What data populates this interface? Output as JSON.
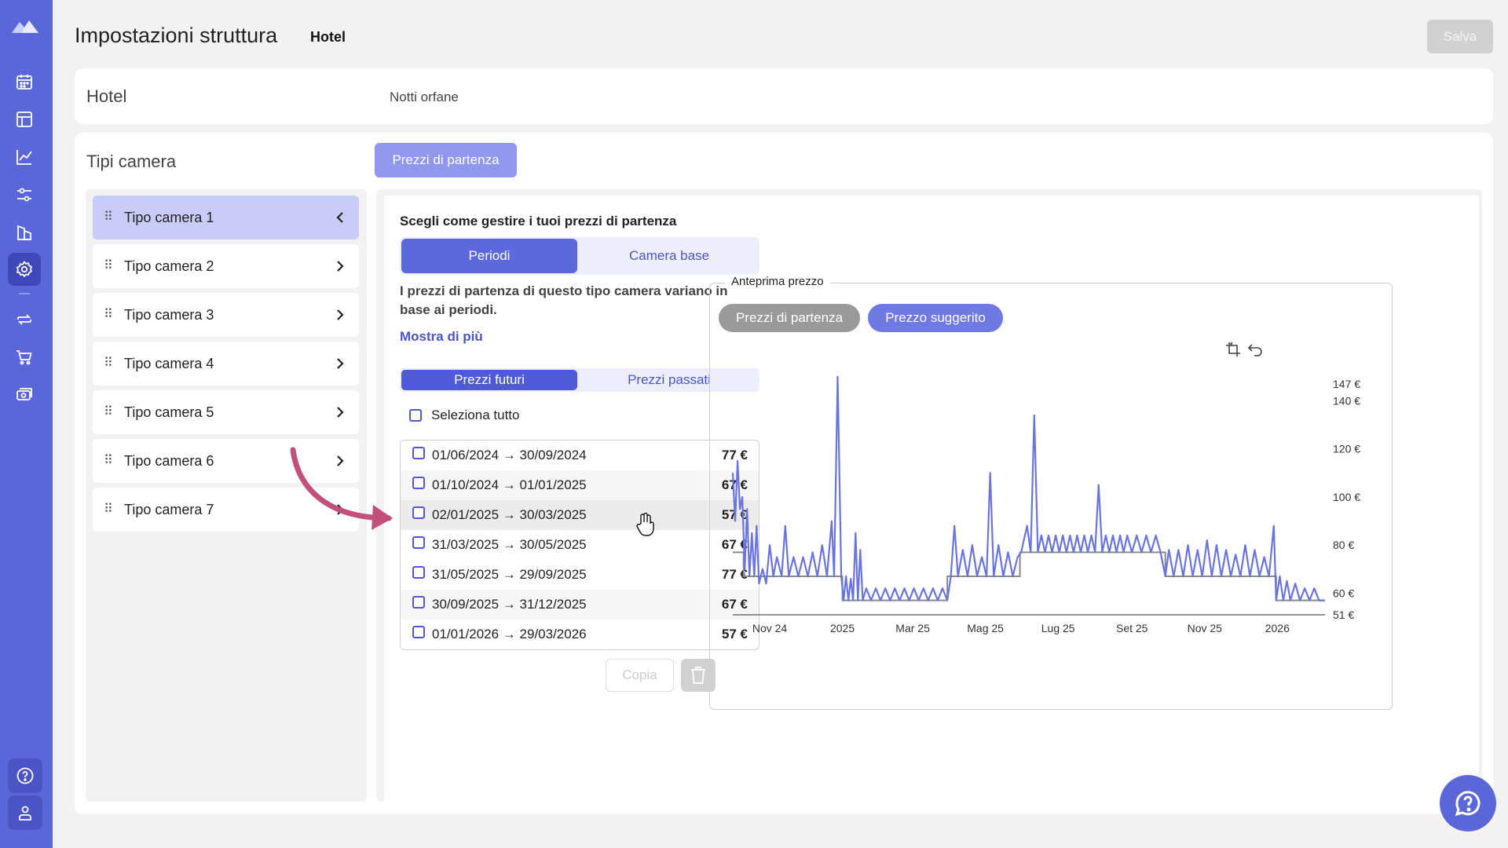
{
  "header": {
    "title": "Impostazioni struttura",
    "subtitle": "Hotel",
    "save_label": "Salva"
  },
  "hotel_card": {
    "title": "Hotel",
    "tab": "Notti orfane"
  },
  "room_card": {
    "title": "Tipi camera",
    "tab": "Prezzi di partenza",
    "rooms": [
      {
        "label": "Tipo camera 1"
      },
      {
        "label": "Tipo camera 2"
      },
      {
        "label": "Tipo camera 3"
      },
      {
        "label": "Tipo camera 4"
      },
      {
        "label": "Tipo camera 5"
      },
      {
        "label": "Tipo camera 6"
      },
      {
        "label": "Tipo camera 7"
      }
    ]
  },
  "pricing": {
    "heading": "Scegli come gestire i tuoi prezzi di partenza",
    "mode_options": [
      "Periodi",
      "Camera base"
    ],
    "description": "I prezzi di partenza di questo tipo camera variano in base ai periodi.",
    "show_more": "Mostra di più",
    "time_options": [
      "Prezzi futuri",
      "Prezzi passati"
    ],
    "select_all": "Seleziona tutto",
    "periods": [
      {
        "range": "01/06/2024 → 30/09/2024",
        "price": "77 €"
      },
      {
        "range": "01/10/2024 → 01/01/2025",
        "price": "67 €"
      },
      {
        "range": "02/01/2025 → 30/03/2025",
        "price": "57 €"
      },
      {
        "range": "31/03/2025 → 30/05/2025",
        "price": "67 €"
      },
      {
        "range": "31/05/2025 → 29/09/2025",
        "price": "77 €"
      },
      {
        "range": "30/09/2025 → 31/12/2025",
        "price": "67 €"
      },
      {
        "range": "01/01/2026 → 29/03/2026",
        "price": "57 €"
      }
    ],
    "copy_label": "Copia"
  },
  "preview": {
    "title": "Anteprima prezzo",
    "pills": [
      "Prezzi di partenza",
      "Prezzo suggerito"
    ]
  },
  "colors": {
    "nav": "#5b67d9",
    "accent": "#5c68dc",
    "base_price_line": "#8a8a8a",
    "suggested_line": "#6a74e0"
  },
  "chart_data": {
    "type": "line",
    "x_tick_labels": [
      "Nov 24",
      "2025",
      "Mar 25",
      "Mag 25",
      "Lug 25",
      "Set 25",
      "Nov 25",
      "2026"
    ],
    "y_tick_labels": [
      "147 €",
      "140 €",
      "120 €",
      "100 €",
      "80 €",
      "60 €",
      "51 €"
    ],
    "ylim": [
      51,
      147
    ],
    "x_start": "2024-10-01",
    "x_end": "2026-02-10",
    "series": [
      {
        "name": "Prezzi di partenza",
        "color": "#8a8a8a",
        "points": [
          [
            "2024-10-01",
            77
          ],
          [
            "2024-10-10",
            77
          ],
          [
            "2024-10-10",
            67
          ],
          [
            "2025-01-01",
            67
          ],
          [
            "2025-01-01",
            57
          ],
          [
            "2025-03-30",
            57
          ],
          [
            "2025-03-30",
            67
          ],
          [
            "2025-05-30",
            67
          ],
          [
            "2025-05-30",
            77
          ],
          [
            "2025-09-29",
            77
          ],
          [
            "2025-09-29",
            67
          ],
          [
            "2025-12-31",
            67
          ],
          [
            "2025-12-31",
            57
          ],
          [
            "2026-02-10",
            57
          ]
        ]
      },
      {
        "name": "Prezzo suggerito",
        "color": "#6a74e0",
        "points": [
          [
            "2024-10-01",
            110
          ],
          [
            "2024-10-03",
            90
          ],
          [
            "2024-10-05",
            115
          ],
          [
            "2024-10-07",
            95
          ],
          [
            "2024-10-09",
            100
          ],
          [
            "2024-10-11",
            70
          ],
          [
            "2024-10-13",
            95
          ],
          [
            "2024-10-15",
            67
          ],
          [
            "2024-10-17",
            85
          ],
          [
            "2024-10-19",
            67
          ],
          [
            "2024-10-21",
            88
          ],
          [
            "2024-10-23",
            64
          ],
          [
            "2024-10-26",
            70
          ],
          [
            "2024-10-29",
            64
          ],
          [
            "2024-11-01",
            80
          ],
          [
            "2024-11-04",
            67
          ],
          [
            "2024-11-07",
            75
          ],
          [
            "2024-11-11",
            67
          ],
          [
            "2024-11-14",
            88
          ],
          [
            "2024-11-17",
            67
          ],
          [
            "2024-11-21",
            75
          ],
          [
            "2024-11-25",
            67
          ],
          [
            "2024-11-29",
            75
          ],
          [
            "2024-12-03",
            67
          ],
          [
            "2024-12-07",
            77
          ],
          [
            "2024-12-11",
            67
          ],
          [
            "2024-12-15",
            80
          ],
          [
            "2024-12-19",
            67
          ],
          [
            "2024-12-23",
            90
          ],
          [
            "2024-12-25",
            67
          ],
          [
            "2024-12-28",
            150
          ],
          [
            "2024-12-31",
            67
          ],
          [
            "2025-01-02",
            57
          ],
          [
            "2025-01-04",
            67
          ],
          [
            "2025-01-06",
            57
          ],
          [
            "2025-01-08",
            66
          ],
          [
            "2025-01-10",
            57
          ],
          [
            "2025-01-12",
            85
          ],
          [
            "2025-01-14",
            57
          ],
          [
            "2025-01-16",
            78
          ],
          [
            "2025-01-18",
            57
          ],
          [
            "2025-01-21",
            62
          ],
          [
            "2025-01-25",
            57
          ],
          [
            "2025-01-29",
            62
          ],
          [
            "2025-02-02",
            57
          ],
          [
            "2025-02-06",
            62
          ],
          [
            "2025-02-10",
            57
          ],
          [
            "2025-02-14",
            62
          ],
          [
            "2025-02-18",
            57
          ],
          [
            "2025-02-22",
            62
          ],
          [
            "2025-02-26",
            57
          ],
          [
            "2025-03-02",
            62
          ],
          [
            "2025-03-06",
            57
          ],
          [
            "2025-03-10",
            62
          ],
          [
            "2025-03-14",
            57
          ],
          [
            "2025-03-18",
            62
          ],
          [
            "2025-03-22",
            57
          ],
          [
            "2025-03-26",
            62
          ],
          [
            "2025-03-30",
            57
          ],
          [
            "2025-04-02",
            67
          ],
          [
            "2025-04-05",
            88
          ],
          [
            "2025-04-08",
            67
          ],
          [
            "2025-04-12",
            78
          ],
          [
            "2025-04-16",
            67
          ],
          [
            "2025-04-20",
            80
          ],
          [
            "2025-04-24",
            67
          ],
          [
            "2025-04-28",
            75
          ],
          [
            "2025-05-02",
            67
          ],
          [
            "2025-05-05",
            110
          ],
          [
            "2025-05-08",
            67
          ],
          [
            "2025-05-12",
            80
          ],
          [
            "2025-05-16",
            67
          ],
          [
            "2025-05-20",
            77
          ],
          [
            "2025-05-24",
            67
          ],
          [
            "2025-05-28",
            75
          ],
          [
            "2025-05-31",
            77
          ],
          [
            "2025-06-05",
            88
          ],
          [
            "2025-06-08",
            77
          ],
          [
            "2025-06-11",
            134
          ],
          [
            "2025-06-14",
            77
          ],
          [
            "2025-06-17",
            84
          ],
          [
            "2025-06-20",
            77
          ],
          [
            "2025-06-23",
            84
          ],
          [
            "2025-06-26",
            77
          ],
          [
            "2025-06-29",
            84
          ],
          [
            "2025-07-02",
            77
          ],
          [
            "2025-07-05",
            84
          ],
          [
            "2025-07-08",
            77
          ],
          [
            "2025-07-11",
            84
          ],
          [
            "2025-07-14",
            77
          ],
          [
            "2025-07-17",
            84
          ],
          [
            "2025-07-20",
            77
          ],
          [
            "2025-07-23",
            84
          ],
          [
            "2025-07-26",
            77
          ],
          [
            "2025-07-29",
            84
          ],
          [
            "2025-08-01",
            77
          ],
          [
            "2025-08-04",
            105
          ],
          [
            "2025-08-07",
            77
          ],
          [
            "2025-08-10",
            84
          ],
          [
            "2025-08-13",
            77
          ],
          [
            "2025-08-16",
            84
          ],
          [
            "2025-08-19",
            77
          ],
          [
            "2025-08-22",
            84
          ],
          [
            "2025-08-25",
            77
          ],
          [
            "2025-08-28",
            84
          ],
          [
            "2025-09-01",
            77
          ],
          [
            "2025-09-05",
            84
          ],
          [
            "2025-09-09",
            77
          ],
          [
            "2025-09-13",
            84
          ],
          [
            "2025-09-17",
            77
          ],
          [
            "2025-09-21",
            84
          ],
          [
            "2025-09-25",
            77
          ],
          [
            "2025-09-29",
            67
          ],
          [
            "2025-10-02",
            78
          ],
          [
            "2025-10-06",
            67
          ],
          [
            "2025-10-10",
            78
          ],
          [
            "2025-10-14",
            67
          ],
          [
            "2025-10-18",
            80
          ],
          [
            "2025-10-22",
            67
          ],
          [
            "2025-10-26",
            78
          ],
          [
            "2025-10-30",
            67
          ],
          [
            "2025-11-03",
            82
          ],
          [
            "2025-11-07",
            67
          ],
          [
            "2025-11-11",
            80
          ],
          [
            "2025-11-15",
            67
          ],
          [
            "2025-11-19",
            78
          ],
          [
            "2025-11-23",
            67
          ],
          [
            "2025-11-27",
            76
          ],
          [
            "2025-12-01",
            67
          ],
          [
            "2025-12-05",
            80
          ],
          [
            "2025-12-09",
            67
          ],
          [
            "2025-12-13",
            78
          ],
          [
            "2025-12-17",
            67
          ],
          [
            "2025-12-21",
            75
          ],
          [
            "2025-12-25",
            67
          ],
          [
            "2025-12-29",
            88
          ],
          [
            "2025-12-31",
            57
          ],
          [
            "2026-01-03",
            67
          ],
          [
            "2026-01-06",
            57
          ],
          [
            "2026-01-09",
            65
          ],
          [
            "2026-01-12",
            57
          ],
          [
            "2026-01-16",
            64
          ],
          [
            "2026-01-20",
            57
          ],
          [
            "2026-01-24",
            62
          ],
          [
            "2026-01-28",
            57
          ],
          [
            "2026-02-01",
            62
          ],
          [
            "2026-02-05",
            57
          ],
          [
            "2026-02-10",
            57
          ]
        ]
      }
    ]
  }
}
